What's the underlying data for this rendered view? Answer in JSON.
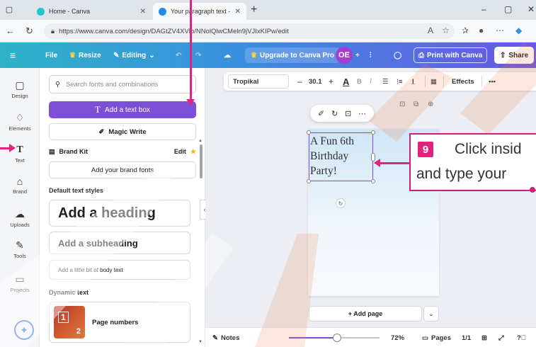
{
  "browser": {
    "tabs": [
      {
        "title": "Home - Canva",
        "active": false
      },
      {
        "title": "Your paragraph text - Invitation (",
        "active": true
      }
    ],
    "url": "https://www.canva.com/design/DAGtZV4XVlo/NNolQlwCMeln9jVJIxKIPw/edit",
    "controls": {
      "minimize": "–",
      "maximize": "▢",
      "close": "✕"
    }
  },
  "canva_toolbar": {
    "menu_icon": "≡",
    "file": "File",
    "resize": "Resize",
    "editing": "Editing",
    "upgrade": "Upgrade to Canva Pro",
    "avatar": "OE",
    "print": "Print with Canva",
    "share": "Share",
    "colors": {
      "start": "#2eb3c8",
      "end": "#6a57e3"
    }
  },
  "rail": {
    "items": [
      {
        "label": "Design",
        "icon": "▢"
      },
      {
        "label": "Elements",
        "icon": "♢"
      },
      {
        "label": "Text",
        "icon": "T"
      },
      {
        "label": "Brand",
        "icon": "⌂"
      },
      {
        "label": "Uploads",
        "icon": "☁"
      },
      {
        "label": "Tools",
        "icon": "✎"
      },
      {
        "label": "Projects",
        "icon": "▭"
      }
    ]
  },
  "panel": {
    "search_placeholder": "Search fonts and combinations",
    "add_text_box": "Add a text box",
    "magic_write": "Magic Write",
    "brand_kit": "Brand Kit",
    "brand_edit": "Edit",
    "brand_fonts": "Add your brand fonts",
    "default_styles_label": "Default text styles",
    "heading": "Add a heading",
    "subheading": "Add a subheading",
    "body": "Add a little bit of body text",
    "dynamic_label": "Dynamic text",
    "page_numbers": "Page numbers",
    "page_thumb_1": "1",
    "page_thumb_2": "2"
  },
  "format_bar": {
    "font": "Tropikal",
    "minus": "–",
    "size": "30.1",
    "plus": "+",
    "effects": "Effects",
    "more": "•••"
  },
  "canvas": {
    "text_lines": [
      "A Fun 6th",
      "Birthday",
      "Party!"
    ],
    "add_page": "+ Add page"
  },
  "callout": {
    "step": "9",
    "line1": "Click insid",
    "line2": "and type your"
  },
  "bottom_bar": {
    "notes": "Notes",
    "zoom": "72%",
    "zoom_level": 0.53,
    "pages": "Pages",
    "page_count": "1/1"
  },
  "accent": {
    "purple": "#7d4fd6",
    "callout": "#e0247e"
  }
}
